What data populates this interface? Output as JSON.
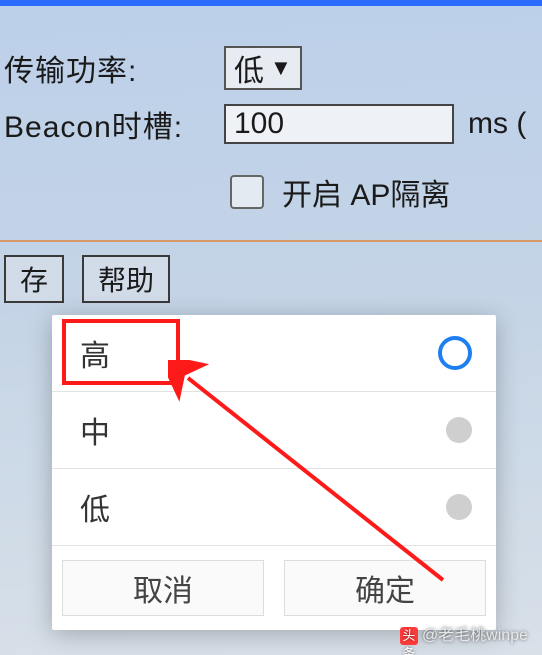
{
  "form": {
    "tx_power_label": "传输功率:",
    "tx_power_value": "低",
    "beacon_label": "Beacon时槽:",
    "beacon_value": "100",
    "beacon_unit": "ms (",
    "ap_isolation_label": "开启 AP隔离"
  },
  "buttons": {
    "save": "存",
    "help": "帮助"
  },
  "popup": {
    "options": [
      "高",
      "中",
      "低"
    ],
    "selected_index": 0,
    "cancel": "取消",
    "confirm": "确定"
  },
  "watermark": {
    "prefix": "头条",
    "text": "@老毛桃winpe"
  },
  "icons": {
    "dropdown_triangle": "▼"
  }
}
